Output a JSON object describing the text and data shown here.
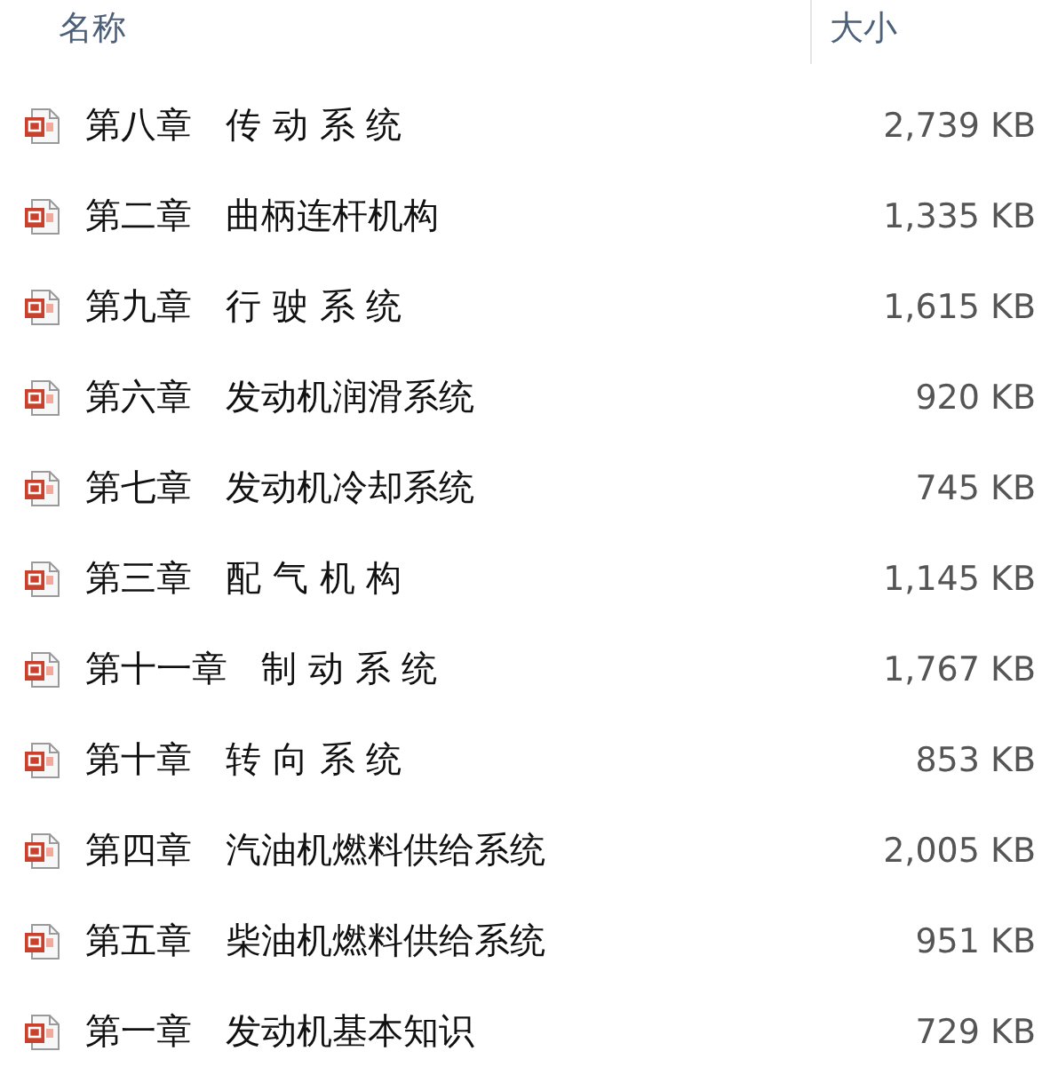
{
  "columns": [
    "名称",
    "大小"
  ],
  "files": [
    {
      "name": "第八章   传 动 系 统",
      "size": "2,739 KB"
    },
    {
      "name": "第二章   曲柄连杆机构",
      "size": "1,335 KB"
    },
    {
      "name": "第九章   行 驶 系 统",
      "size": "1,615 KB"
    },
    {
      "name": "第六章   发动机润滑系统",
      "size": "920 KB"
    },
    {
      "name": "第七章   发动机冷却系统",
      "size": "745 KB"
    },
    {
      "name": "第三章   配 气 机 构",
      "size": "1,145 KB"
    },
    {
      "name": "第十一章   制 动 系 统",
      "size": "1,767 KB"
    },
    {
      "name": "第十章   转 向 系 统",
      "size": "853 KB"
    },
    {
      "name": "第四章   汽油机燃料供给系统",
      "size": "2,005 KB"
    },
    {
      "name": "第五章   柴油机燃料供给系统",
      "size": "951 KB"
    },
    {
      "name": "第一章   发动机基本知识",
      "size": "729 KB"
    }
  ]
}
